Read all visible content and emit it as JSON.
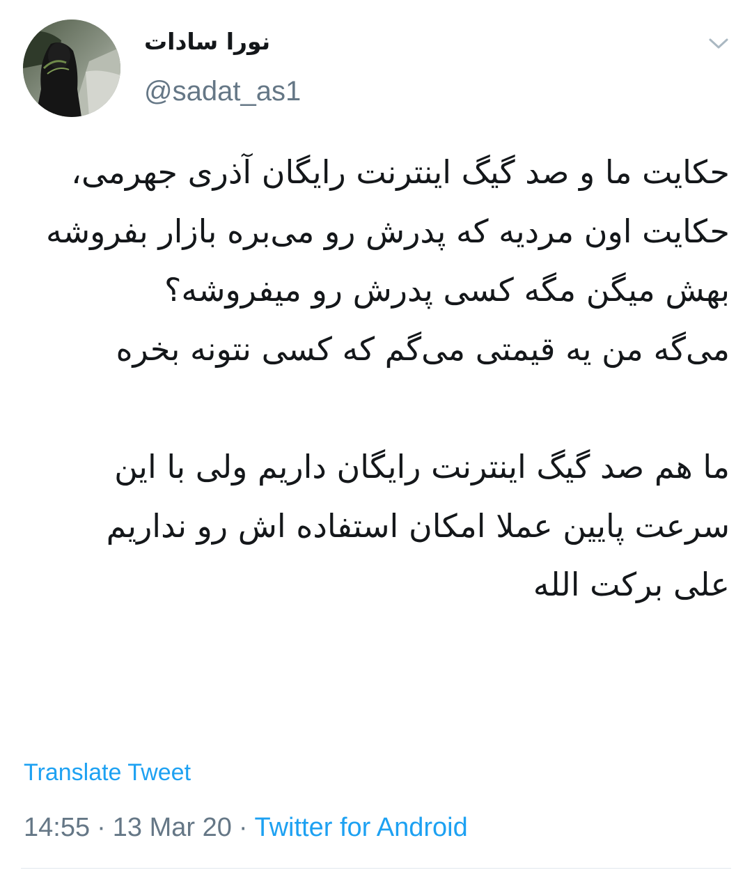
{
  "tweet": {
    "display_name": "نورا سادات",
    "handle": "@sadat_as1",
    "text": "حکایت ما و صد گیگ اینترنت رایگان آذری جهرمی، حکایت اون مردیه که پدرش رو می‌بره بازار بفروشه بهش میگن مگه کسی پدرش رو میفروشه؟\nمی‌گه من یه قیمتی می‌گم که کسی نتونه بخره\n\nما هم صد گیگ اینترنت رایگان داریم ولی با این سرعت پایین عملا امکان استفاده اش رو نداریم\nعلی برکت الله",
    "translate_label": "Translate Tweet",
    "time": "14:55",
    "date": "13 Mar 20",
    "separator": "·",
    "source": "Twitter for Android"
  },
  "icons": {
    "caret": "chevron-down-icon",
    "avatar": "user-avatar"
  },
  "colors": {
    "link": "#1da1f2",
    "secondary_text": "#657786",
    "primary_text": "#14171a",
    "divider": "#e1e8ed"
  }
}
